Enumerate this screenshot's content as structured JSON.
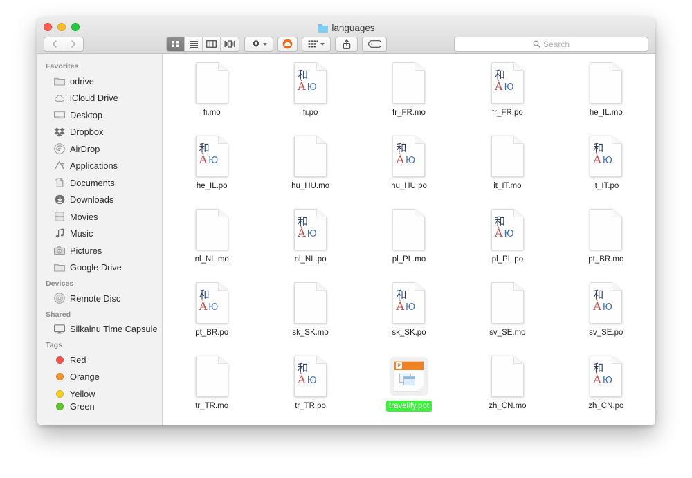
{
  "window": {
    "title": "languages",
    "title_icon": "blue-folder-icon",
    "traffic_lights": [
      {
        "name": "close",
        "color": "#ff5f57"
      },
      {
        "name": "minimize",
        "color": "#ffbd2e"
      },
      {
        "name": "zoom",
        "color": "#28c940"
      }
    ]
  },
  "toolbar": {
    "back_label": "‹",
    "forward_label": "›",
    "view_modes": [
      {
        "name": "icon-view",
        "icon": "grid-icon",
        "active": true
      },
      {
        "name": "list-view",
        "icon": "list-icon",
        "active": false
      },
      {
        "name": "column-view",
        "icon": "columns-icon",
        "active": false
      },
      {
        "name": "cover-flow-view",
        "icon": "coverflow-icon",
        "active": false
      }
    ],
    "action_icon": "gear-icon",
    "dropbox_icon": "dropbox-badge-icon",
    "arrange_icon": "arrange-grid-icon",
    "share_icon": "share-icon",
    "tags_icon": "tag-icon"
  },
  "search": {
    "icon": "search-icon",
    "placeholder": "Search",
    "value": ""
  },
  "sidebar": {
    "sections": [
      {
        "header": "Favorites",
        "items": [
          {
            "label": "odrive",
            "icon": "folder-icon"
          },
          {
            "label": "iCloud Drive",
            "icon": "cloud-icon"
          },
          {
            "label": "Desktop",
            "icon": "desktop-icon"
          },
          {
            "label": "Dropbox",
            "icon": "dropbox-icon"
          },
          {
            "label": "AirDrop",
            "icon": "airdrop-icon"
          },
          {
            "label": "Applications",
            "icon": "applications-icon"
          },
          {
            "label": "Documents",
            "icon": "documents-icon"
          },
          {
            "label": "Downloads",
            "icon": "downloads-icon"
          },
          {
            "label": "Movies",
            "icon": "movies-icon"
          },
          {
            "label": "Music",
            "icon": "music-note-icon"
          },
          {
            "label": "Pictures",
            "icon": "camera-icon"
          },
          {
            "label": "Google Drive",
            "icon": "folder-icon"
          }
        ]
      },
      {
        "header": "Devices",
        "items": [
          {
            "label": "Remote Disc",
            "icon": "optical-disc-icon"
          }
        ]
      },
      {
        "header": "Shared",
        "items": [
          {
            "label": "Silkalnu Time Capsule",
            "icon": "display-icon"
          }
        ]
      },
      {
        "header": "Tags",
        "items": [
          {
            "label": "Red",
            "icon": "tag-dot-icon",
            "color": "#f2534d"
          },
          {
            "label": "Orange",
            "icon": "tag-dot-icon",
            "color": "#f3952b"
          },
          {
            "label": "Yellow",
            "icon": "tag-dot-icon",
            "color": "#f4cf22"
          },
          {
            "label": "Green",
            "icon": "tag-dot-icon",
            "color": "#5fc62e"
          }
        ]
      }
    ]
  },
  "files": [
    {
      "name": "fi.mo",
      "kind": "mo",
      "selected": false
    },
    {
      "name": "fi.po",
      "kind": "po",
      "selected": false
    },
    {
      "name": "fr_FR.mo",
      "kind": "mo",
      "selected": false
    },
    {
      "name": "fr_FR.po",
      "kind": "po",
      "selected": false
    },
    {
      "name": "he_IL.mo",
      "kind": "mo",
      "selected": false
    },
    {
      "name": "he_IL.po",
      "kind": "po",
      "selected": false
    },
    {
      "name": "hu_HU.mo",
      "kind": "mo",
      "selected": false
    },
    {
      "name": "hu_HU.po",
      "kind": "po",
      "selected": false
    },
    {
      "name": "it_IT.mo",
      "kind": "mo",
      "selected": false
    },
    {
      "name": "it_IT.po",
      "kind": "po",
      "selected": false
    },
    {
      "name": "nl_NL.mo",
      "kind": "mo",
      "selected": false
    },
    {
      "name": "nl_NL.po",
      "kind": "po",
      "selected": false
    },
    {
      "name": "pl_PL.mo",
      "kind": "mo",
      "selected": false
    },
    {
      "name": "pl_PL.po",
      "kind": "po",
      "selected": false
    },
    {
      "name": "pt_BR.mo",
      "kind": "mo",
      "selected": false
    },
    {
      "name": "pt_BR.po",
      "kind": "po",
      "selected": false
    },
    {
      "name": "sk_SK.mo",
      "kind": "mo",
      "selected": false
    },
    {
      "name": "sk_SK.po",
      "kind": "po",
      "selected": false
    },
    {
      "name": "sv_SE.mo",
      "kind": "mo",
      "selected": false
    },
    {
      "name": "sv_SE.po",
      "kind": "po",
      "selected": false
    },
    {
      "name": "tr_TR.mo",
      "kind": "mo",
      "selected": false
    },
    {
      "name": "tr_TR.po",
      "kind": "po",
      "selected": false
    },
    {
      "name": "travelify.pot",
      "kind": "pot",
      "selected": true
    },
    {
      "name": "zh_CN.mo",
      "kind": "mo",
      "selected": false
    },
    {
      "name": "zh_CN.po",
      "kind": "po",
      "selected": false
    }
  ],
  "po_icon_glyphs": {
    "han": "和",
    "latin": "À",
    "cyrillic": "Ю"
  },
  "pot_icon": {
    "badge_letter": "P",
    "accent_color": "#ef8023"
  },
  "selection_highlight_color": "#3cf03c"
}
